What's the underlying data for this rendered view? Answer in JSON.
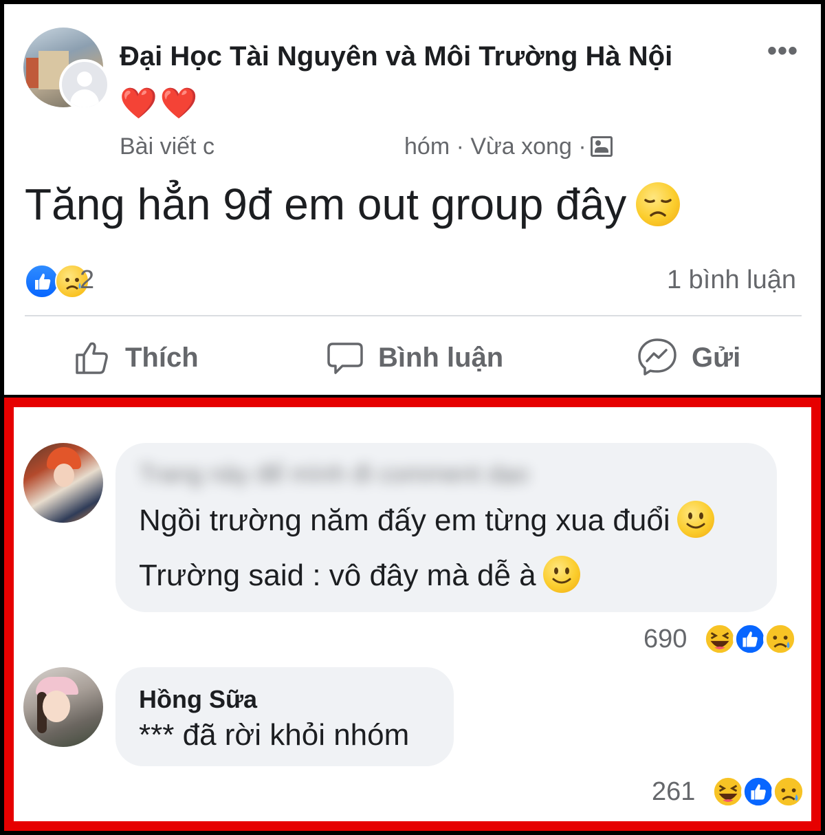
{
  "post": {
    "group_name": "Đại Học Tài Nguyên và Môi Trường Hà Nội",
    "hearts": "❤️❤️",
    "meta_left": "Bài viết c",
    "meta_right": "hóm · Vừa xong ·",
    "text": "Tăng hẳn 9đ em out group đây",
    "reaction_count": "2",
    "comment_count": "1 bình luận",
    "more_icon": "•••"
  },
  "actions": {
    "like": "Thích",
    "comment": "Bình luận",
    "send": "Gửi"
  },
  "comments": [
    {
      "name_blurred": "Trang này để mình đi comment dạo",
      "line1": "Ngồi trường năm đấy em từng xua đuổi",
      "line2": "Trường said : vô đây mà dễ à",
      "reaction_count": "690"
    },
    {
      "name": "Hồng Sữa",
      "text": "*** đã rời khỏi nhóm",
      "reaction_count": "261"
    }
  ],
  "icons": {
    "like": "thumbs-up-icon",
    "comment": "chat-bubble-icon",
    "send": "messenger-icon",
    "more": "more-dots-icon"
  },
  "colors": {
    "highlight_border": "#e60000",
    "like_blue": "#0866ff",
    "text_secondary": "#65676b",
    "bubble_bg": "#f0f2f5"
  }
}
